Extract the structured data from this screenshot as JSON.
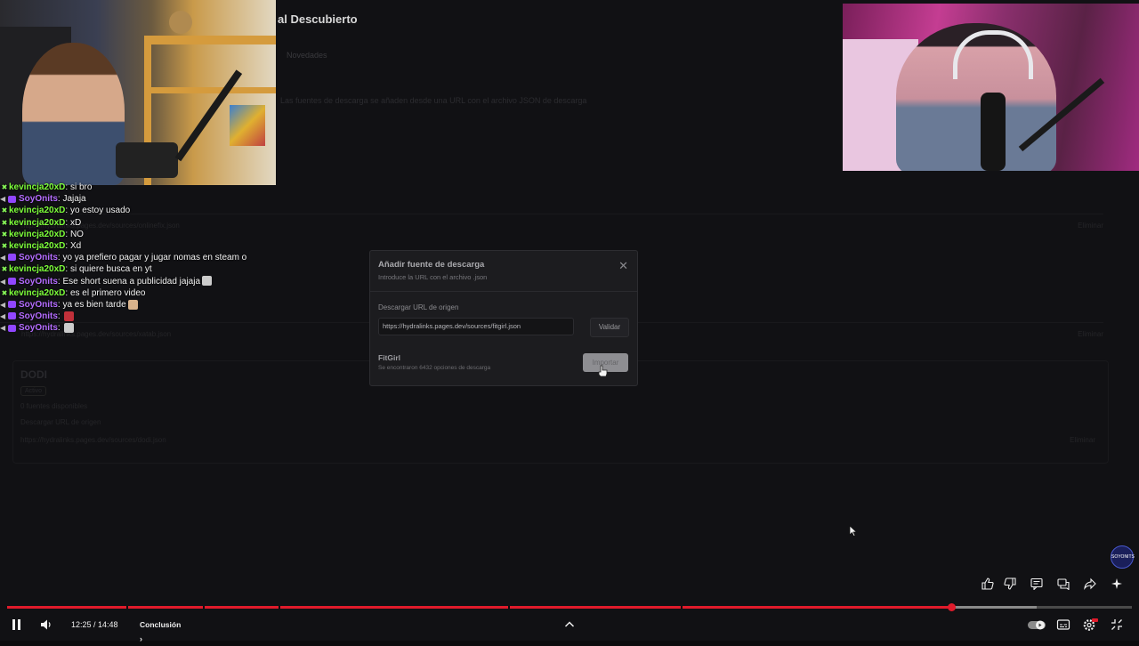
{
  "app": {
    "title": "al Descubierto",
    "tab": "Novedades",
    "description": "Las fuentes de descarga se añaden desde una URL con el archivo JSON de descarga",
    "rows": [
      {
        "url": "https://hydralinks.pages.dev/sources/onlinefix.json",
        "action": "Eliminar"
      },
      {
        "url": "https://hydralinks.pages.dev/sources/xatab.json",
        "action": "Eliminar"
      }
    ],
    "card": {
      "name": "DODI",
      "badge": "Activo",
      "info": "0 fuentes disponibles",
      "url_label": "Descargar URL de origen",
      "url": "https://hydralinks.pages.dev/sources/dodi.json",
      "action": "Eliminar"
    }
  },
  "chat": [
    {
      "user": "kevincja20xD",
      "color": "green",
      "text": "si bro"
    },
    {
      "user": "SoyOnits",
      "color": "purple",
      "text": "Jajaja"
    },
    {
      "user": "kevincja20xD",
      "color": "green",
      "text": "yo estoy usado"
    },
    {
      "user": "kevincja20xD",
      "color": "green",
      "text": "xD"
    },
    {
      "user": "kevincja20xD",
      "color": "green",
      "text": "NO"
    },
    {
      "user": "kevincja20xD",
      "color": "green",
      "text": "Xd"
    },
    {
      "user": "SoyOnits",
      "color": "purple",
      "text": "yo ya prefiero pagar y jugar nomas en steam o"
    },
    {
      "user": "kevincja20xD",
      "color": "green",
      "text": "si quiere busca en yt"
    },
    {
      "user": "SoyOnits",
      "color": "purple",
      "text": "Ese short suena a publicidad jajaja"
    },
    {
      "user": "kevincja20xD",
      "color": "green",
      "text": "es el primero video"
    },
    {
      "user": "SoyOnits",
      "color": "purple",
      "text": "ya es bien tarde"
    },
    {
      "user": "SoyOnits",
      "color": "purple",
      "text": ""
    },
    {
      "user": "SoyOnits",
      "color": "purple",
      "text": ""
    }
  ],
  "modal": {
    "title": "Añadir fuente de descarga",
    "subtitle": "Introduce la URL con el archivo .json",
    "close_icon": "close-icon",
    "url_label": "Descargar URL de origen",
    "url_value": "https://hydralinks.pages.dev/sources/fitgirl.json",
    "validate_label": "Validar",
    "source_name": "FitGirl",
    "source_count": "Se encontraron 6432 opciones de descarga",
    "import_label": "Importar"
  },
  "player": {
    "time": "12:25 / 14:48",
    "chapter": "Conclusión",
    "progress_played_fraction": 0.84,
    "progress_buffered_fraction": 0.915,
    "watermark": "SOYONITS",
    "accent_color": "#e01b2b",
    "icons": [
      "like-icon",
      "dislike-icon",
      "comments-icon",
      "chat-icon",
      "share-icon",
      "sparkle-icon"
    ],
    "bottom_icons": [
      "pause-icon",
      "volume-icon",
      "chevron-up-icon",
      "autoplay-toggle-icon",
      "subtitles-icon",
      "settings-icon",
      "fullscreen-exit-icon"
    ]
  }
}
